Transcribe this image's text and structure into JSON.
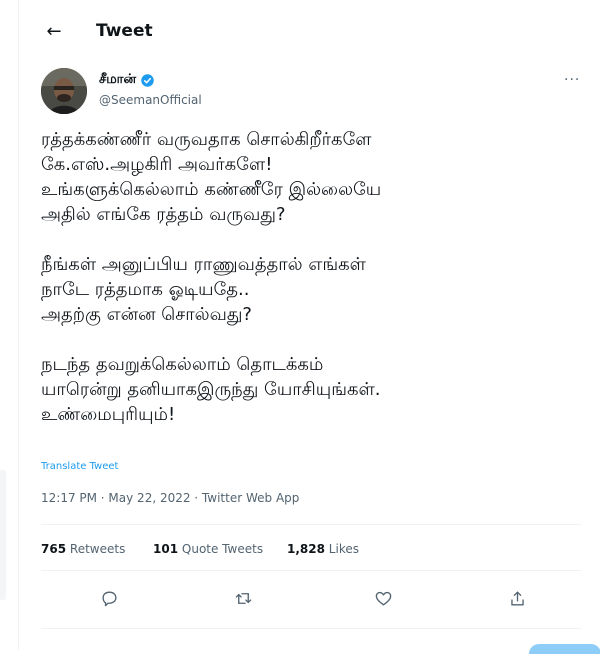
{
  "header": {
    "title": "Tweet"
  },
  "author": {
    "name": "சீமான்",
    "handle": "@SeemanOfficial"
  },
  "tweet": {
    "text": "ரத்தக்கண்ணீர் வருவதாக சொல்கிறீர்களே\nகே.எஸ்.அழகிரி அவர்களே!\nஉங்களுக்கெல்லாம் கண்ணீரே இல்லையே\nஅதில் எங்கே ரத்தம் வருவது?\n\nநீங்கள் அனுப்பிய ராணுவத்தால் எங்கள்\nநாடே ரத்தமாக ஓடியதே..\nஅதற்கு என்ன சொல்வது?\n\nநடந்த தவறுக்கெல்லாம் தொடக்கம்\nயாரென்று தனியாகஇருந்து யோசியுங்கள்.\nஉண்மைபுரியும்!",
    "translate_label": "Translate Tweet",
    "timestamp": "12:17 PM · May 22, 2022 · Twitter Web App"
  },
  "stats": {
    "retweets_count": "765",
    "retweets_label": "Retweets",
    "quotes_count": "101",
    "quotes_label": "Quote Tweets",
    "likes_count": "1,828",
    "likes_label": "Likes"
  },
  "icons": {
    "back": "arrow-left-icon",
    "verified": "verified-badge-icon",
    "more": "more-horizontal-icon",
    "reply": "reply-icon",
    "retweet": "retweet-icon",
    "like": "heart-icon",
    "share": "share-icon"
  },
  "colors": {
    "accent": "#1d9bf0",
    "text": "#0f1419",
    "muted": "#536471",
    "border": "#eff3f4"
  }
}
